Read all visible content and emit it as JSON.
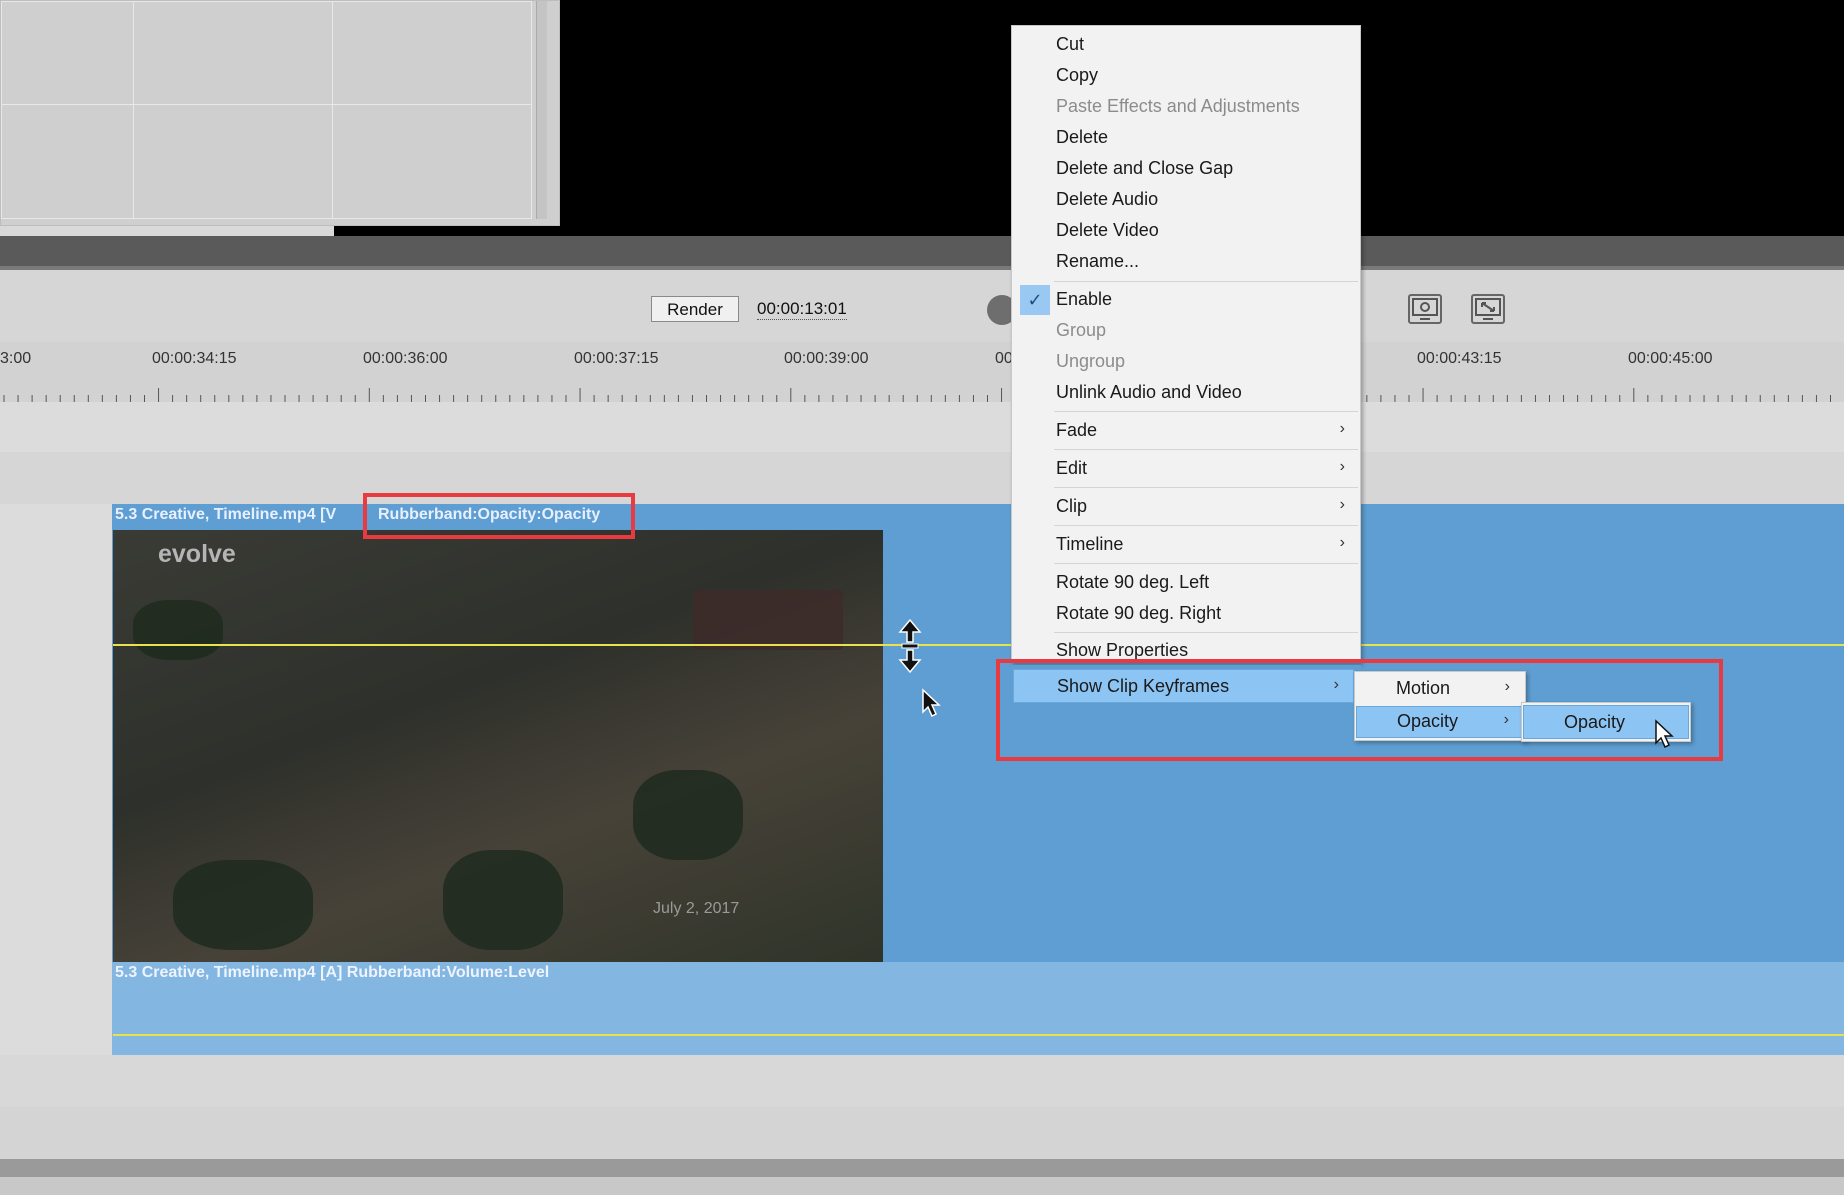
{
  "toolbar": {
    "render_label": "Render",
    "timecode": "00:00:13:01",
    "settings_icon": "monitor-settings-icon",
    "fullscreen_icon": "monitor-expand-icon"
  },
  "ruler": {
    "labels": [
      "3:00",
      "00:00:34:15",
      "00:00:36:00",
      "00:00:37:15",
      "00:00:39:00",
      "00",
      "00:00:43:15",
      "00:00:45:00"
    ]
  },
  "video_clip": {
    "label": "5.3 Creative, Timeline.mp4 [V",
    "rubberband_label": "Rubberband:Opacity:Opacity",
    "thumb_logo": "evolve",
    "thumb_date": "July 2, 2017"
  },
  "audio_clip": {
    "label": "5.3 Creative, Timeline.mp4 [A] Rubberband:Volume:Level"
  },
  "context_menu": {
    "cut": "Cut",
    "copy": "Copy",
    "paste_effects": "Paste Effects and Adjustments",
    "delete": "Delete",
    "delete_close_gap": "Delete and Close Gap",
    "delete_audio": "Delete Audio",
    "delete_video": "Delete Video",
    "rename": "Rename...",
    "enable": "Enable",
    "group": "Group",
    "ungroup": "Ungroup",
    "unlink": "Unlink Audio and Video",
    "fade": "Fade",
    "edit": "Edit",
    "clip": "Clip",
    "timeline": "Timeline",
    "rotate_left": "Rotate 90 deg. Left",
    "rotate_right": "Rotate 90 deg. Right",
    "show_properties": "Show Properties",
    "show_clip_keyframes": "Show Clip Keyframes"
  },
  "submenu_keyframes": {
    "motion": "Motion",
    "opacity": "Opacity"
  },
  "submenu_opacity": {
    "opacity": "Opacity"
  },
  "colors": {
    "clip_blue": "#5e9ed2",
    "audio_blue": "#83b6e1",
    "highlight": "#8cc4f4",
    "annotation_red": "#e83a41",
    "rubberband_yellow": "#e8e34c"
  }
}
